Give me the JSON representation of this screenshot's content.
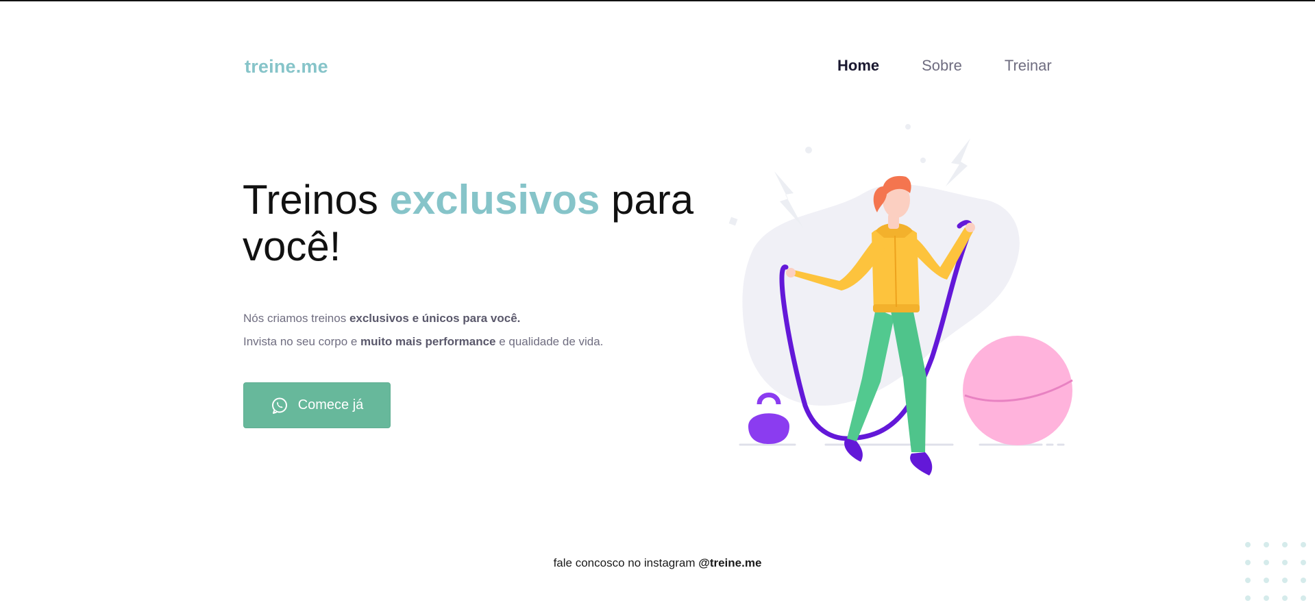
{
  "brand": {
    "logo": "treine.me"
  },
  "nav": {
    "items": [
      {
        "label": "Home",
        "active": true
      },
      {
        "label": "Sobre",
        "active": false
      },
      {
        "label": "Treinar",
        "active": false
      }
    ]
  },
  "hero": {
    "title_part1": "Treinos ",
    "title_accent": "exclusivos",
    "title_part2": " para você!",
    "line1_normal": "Nós criamos treinos ",
    "line1_bold": "exclusivos e únicos para você.",
    "line2_normal": "Invista no seu corpo e ",
    "line2_bold": "muito mais performance",
    "line2_end": " e qualidade de vida.",
    "cta_label": "Comece já"
  },
  "footer": {
    "text": "fale concosco no instagram ",
    "handle": "@treine.me"
  },
  "colors": {
    "accent": "#86c4c9",
    "button": "#67b89b",
    "text_muted": "#6f6d80"
  },
  "icons": {
    "cta": "whatsapp-icon"
  }
}
